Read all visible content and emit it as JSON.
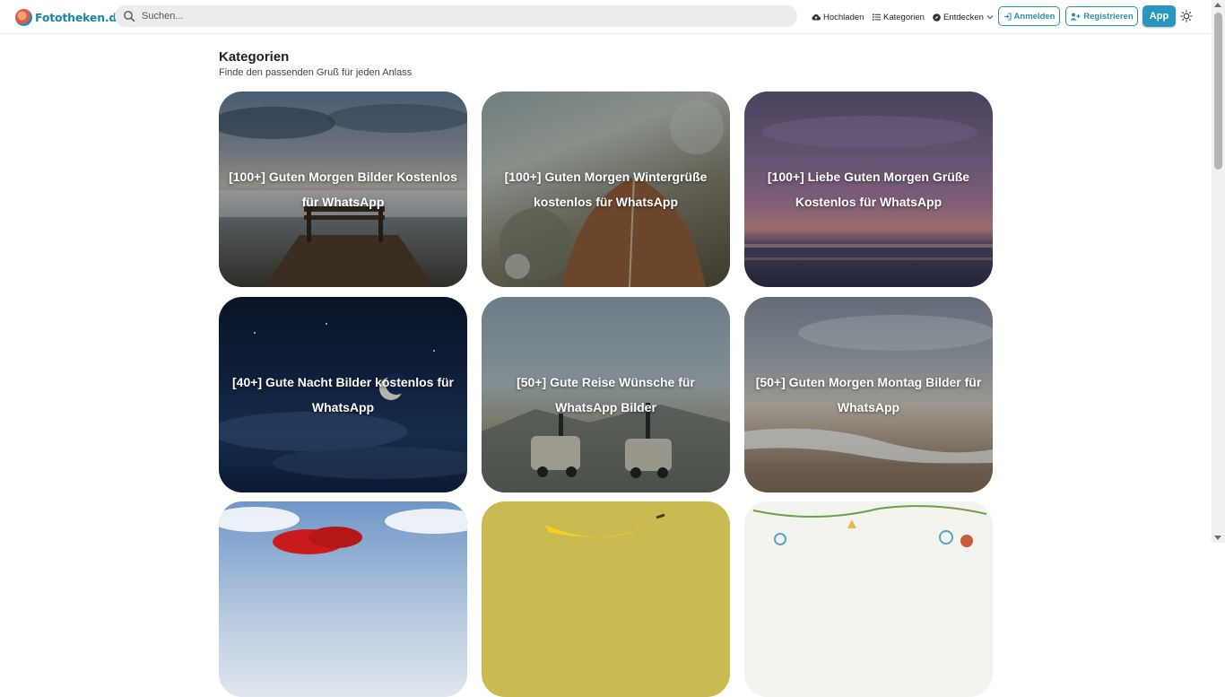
{
  "header": {
    "logo_text": "Fototheken.de",
    "search_placeholder": "Suchen...",
    "nav_upload": "Hochladen",
    "nav_categories": "Kategorien",
    "nav_discover": "Entdecken",
    "login": "Anmelden",
    "register": "Registrieren",
    "app": "App"
  },
  "page": {
    "title": "Kategorien",
    "subtitle": "Finde den passenden Gruß für jeden Anlass"
  },
  "cards": [
    {
      "title": "[100+] Guten Morgen Bilder Kostenlos für WhatsApp"
    },
    {
      "title": "[100+] Guten Morgen Wintergrüße kostenlos für WhatsApp"
    },
    {
      "title": "[100+] Liebe Guten Morgen Grüße Kostenlos für WhatsApp"
    },
    {
      "title": "[40+] Gute Nacht Bilder kostenlos für WhatsApp"
    },
    {
      "title": "[50+] Gute Reise Wünsche für WhatsApp Bilder"
    },
    {
      "title": "[50+] Guten Morgen Montag Bilder für WhatsApp"
    }
  ],
  "colors": {
    "brand": "#2a8fb0",
    "app_button": "#2a95bd"
  },
  "icons": [
    "search-icon",
    "cloud-upload-icon",
    "list-icon",
    "compass-icon",
    "chevron-down-icon",
    "sign-in-icon",
    "user-plus-icon",
    "sun-icon"
  ]
}
